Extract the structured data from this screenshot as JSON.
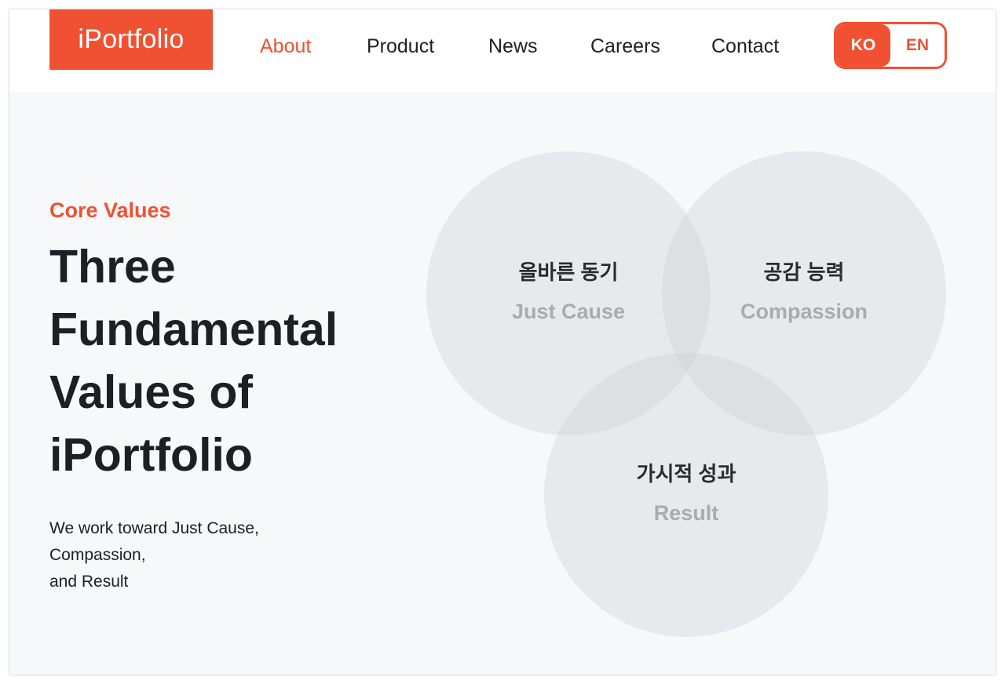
{
  "colors": {
    "accent": "#f05133",
    "text": "#1e1f24",
    "section_bg": "#f7f8fa",
    "circle_fill": "rgba(205,207,212,0.38)",
    "circle_en_text": "#a9abb0"
  },
  "header": {
    "logo_text": "iPortfolio",
    "nav": [
      {
        "label": "About",
        "active": true
      },
      {
        "label": "Product",
        "active": false
      },
      {
        "label": "News",
        "active": false
      },
      {
        "label": "Careers",
        "active": false
      },
      {
        "label": "Contact",
        "active": false
      }
    ],
    "lang": {
      "ko_label": "KO",
      "en_label": "EN",
      "selected": "KO"
    }
  },
  "hero": {
    "eyebrow": "Core Values",
    "headline_lines": [
      "Three",
      "Fundamental",
      "Values of",
      "iPortfolio"
    ],
    "description_lines": [
      "We work toward Just Cause,",
      "Compassion,",
      "and Result"
    ]
  },
  "values": [
    {
      "ko": "올바른 동기",
      "en": "Just Cause"
    },
    {
      "ko": "공감 능력",
      "en": "Compassion"
    },
    {
      "ko": "가시적 성과",
      "en": "Result"
    }
  ]
}
